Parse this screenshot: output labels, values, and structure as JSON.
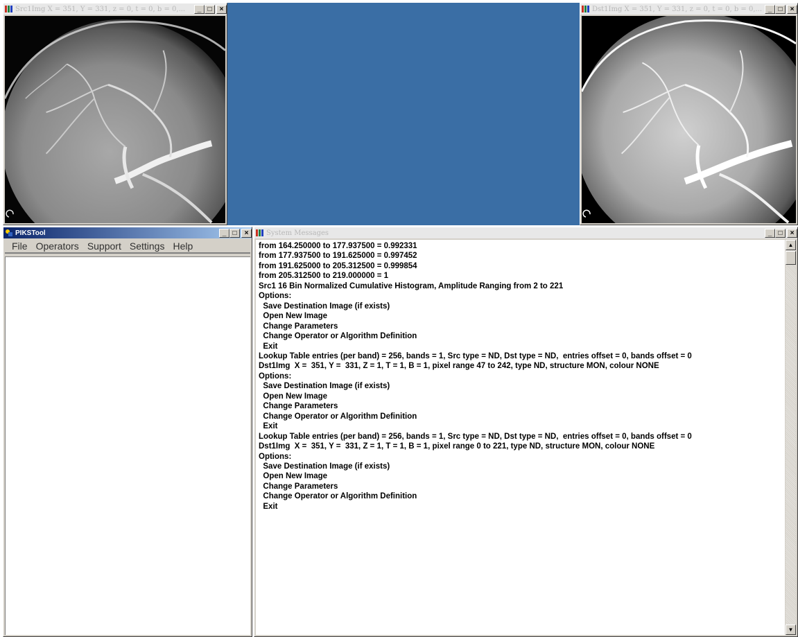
{
  "src_window": {
    "title": "Src1Img  X = 351, Y = 331, z = 0, t = 0, b = 0,...",
    "buttons": {
      "minimize": "_",
      "maximize": "□",
      "close": "×"
    }
  },
  "dst_window": {
    "title": "Dst1Img  X = 351, Y = 331, z = 0, t = 0, b = 0,...",
    "buttons": {
      "minimize": "_",
      "maximize": "□",
      "close": "×"
    }
  },
  "piks_window": {
    "title": "PIKSTool",
    "menu": [
      "File",
      "Operators",
      "Support",
      "Settings",
      "Help"
    ],
    "buttons": {
      "minimize": "_",
      "maximize": "□",
      "close": "×"
    }
  },
  "messages_window": {
    "title": "System Messages",
    "buttons": {
      "minimize": "_",
      "maximize": "□",
      "close": "×"
    },
    "scroll_up": "▲",
    "scroll_down": "▼",
    "lines": [
      "from 164.250000 to 177.937500 = 0.992331",
      "from 177.937500 to 191.625000 = 0.997452",
      "from 191.625000 to 205.312500 = 0.999854",
      "from 205.312500 to 219.000000 = 1",
      "Src1 16 Bin Normalized Cumulative Histogram, Amplitude Ranging from 2 to 221",
      "Options:",
      "  Save Destination Image (if exists)",
      "  Open New Image",
      "  Change Parameters",
      "  Change Operator or Algorithm Definition",
      "  Exit",
      "Lookup Table entries (per band) = 256, bands = 1, Src type = ND, Dst type = ND,  entries offset = 0, bands offset = 0",
      "Dst1Img  X =  351, Y =  331, Z = 1, T = 1, B = 1, pixel range 47 to 242, type ND, structure MON, colour NONE",
      "Options:",
      "  Save Destination Image (if exists)",
      "  Open New Image",
      "  Change Parameters",
      "  Change Operator or Algorithm Definition",
      "  Exit",
      "Lookup Table entries (per band) = 256, bands = 1, Src type = ND, Dst type = ND,  entries offset = 0, bands offset = 0",
      "Dst1Img  X =  351, Y =  331, Z = 1, T = 1, B = 1, pixel range 0 to 221, type ND, structure MON, colour NONE",
      "Options:",
      "  Save Destination Image (if exists)",
      "  Open New Image",
      "  Change Parameters",
      "  Change Operator or Algorithm Definition",
      "  Exit"
    ]
  },
  "colors": {
    "desktop_blue": "#3a6ea5",
    "window_face": "#d4d0c8",
    "active_title": "#0a246a"
  }
}
